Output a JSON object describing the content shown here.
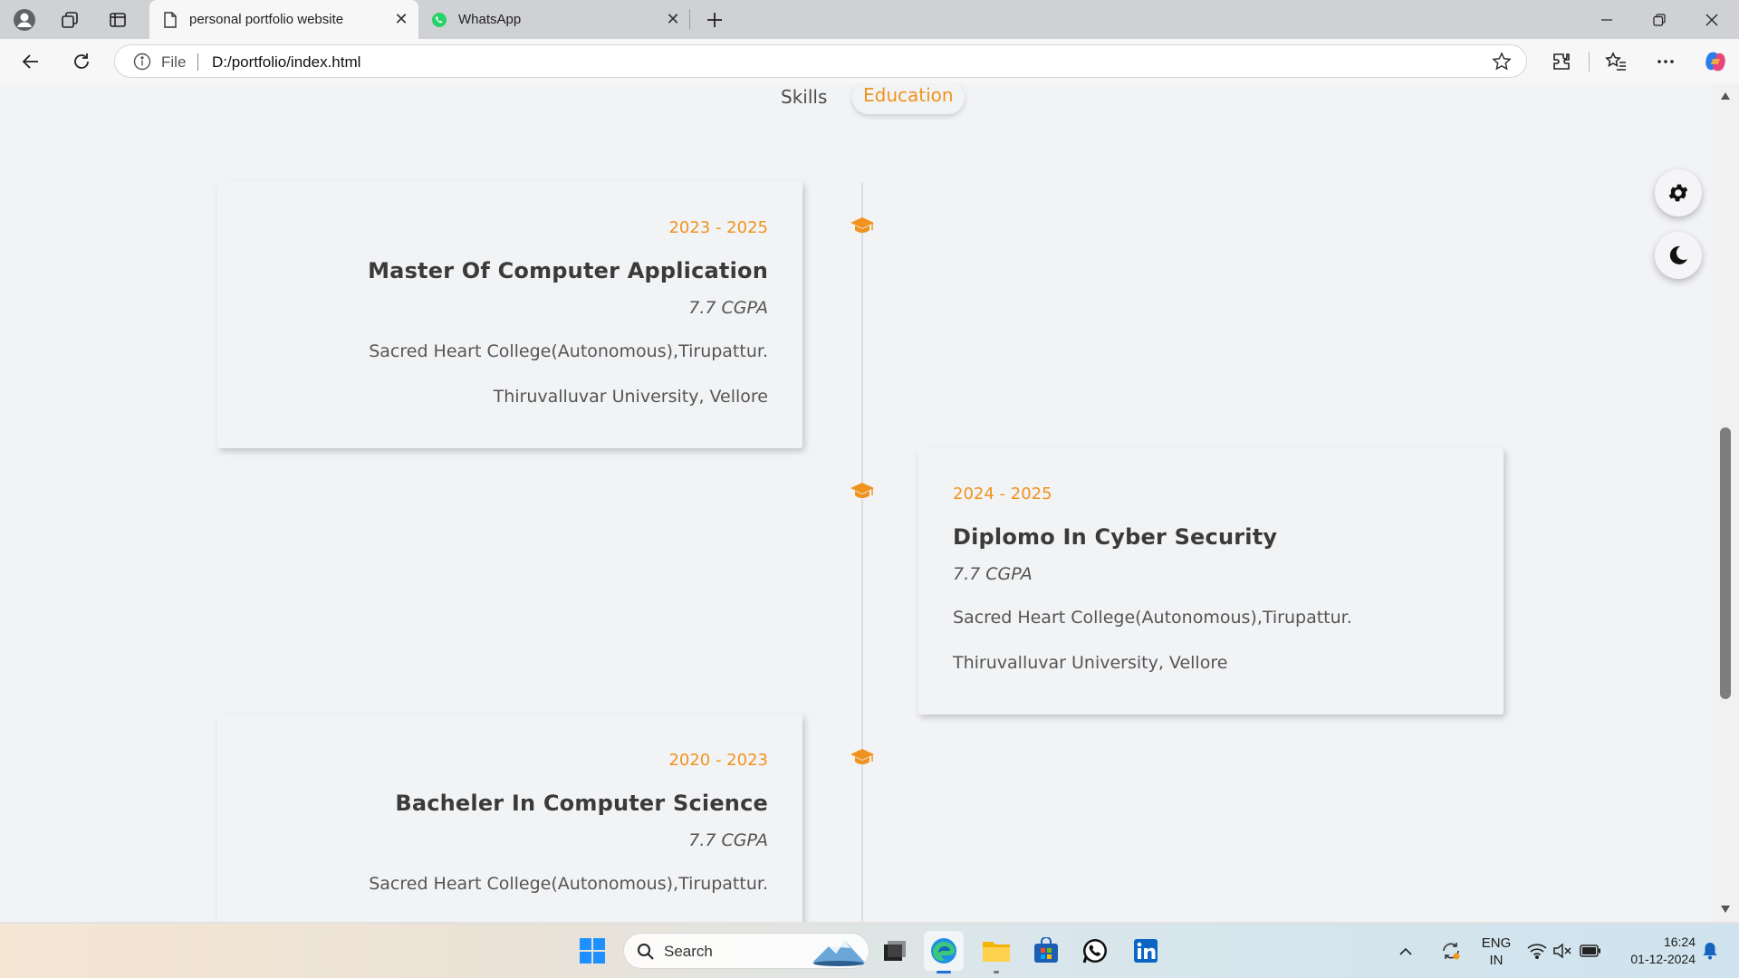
{
  "browser": {
    "tabs": [
      {
        "title": "personal portfolio website",
        "active": true
      },
      {
        "title": "WhatsApp",
        "active": false
      }
    ],
    "address": {
      "scheme_label": "File",
      "url": "D:/portfolio/index.html"
    }
  },
  "page": {
    "nav_tabs": [
      {
        "label": "Skills",
        "active": false
      },
      {
        "label": "Education",
        "active": true
      }
    ],
    "education": [
      {
        "years": "2023 - 2025",
        "degree": "Master Of Computer Application",
        "cgpa": "7.7 CGPA",
        "college": "Sacred Heart College(Autonomous),Tirupattur.",
        "university": "Thiruvalluvar University, Vellore"
      },
      {
        "years": "2024 - 2025",
        "degree": "Diplomo In Cyber Security",
        "cgpa": "7.7 CGPA",
        "college": "Sacred Heart College(Autonomous),Tirupattur.",
        "university": "Thiruvalluvar University, Vellore"
      },
      {
        "years": "2020 - 2023",
        "degree": "Bacheler In Computer Science",
        "cgpa": "7.7 CGPA",
        "college": "Sacred Heart College(Autonomous),Tirupattur."
      }
    ],
    "accent_color": "#f0931e"
  },
  "taskbar": {
    "search_placeholder": "Search",
    "language": "ENG",
    "region": "IN",
    "time": "16:24",
    "date": "01-12-2024"
  }
}
